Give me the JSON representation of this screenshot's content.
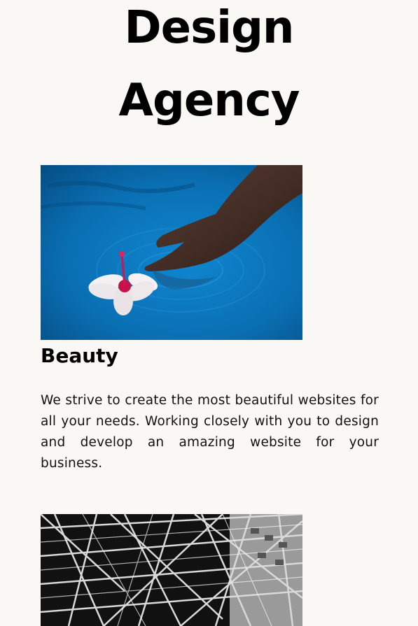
{
  "hero": {
    "title_line1": "Design",
    "title_line2": "Agency"
  },
  "cards": [
    {
      "image_icon": "flower-in-water-photo",
      "title": "Beauty",
      "text": "We strive to create the most beautiful websites for all your needs. Working closely with you to design and develop an amazing website for your business."
    },
    {
      "image_icon": "steel-structure-photo"
    }
  ],
  "colors": {
    "background": "#f9f8f4",
    "heading": "#000000",
    "water": "#0b6fb4"
  }
}
